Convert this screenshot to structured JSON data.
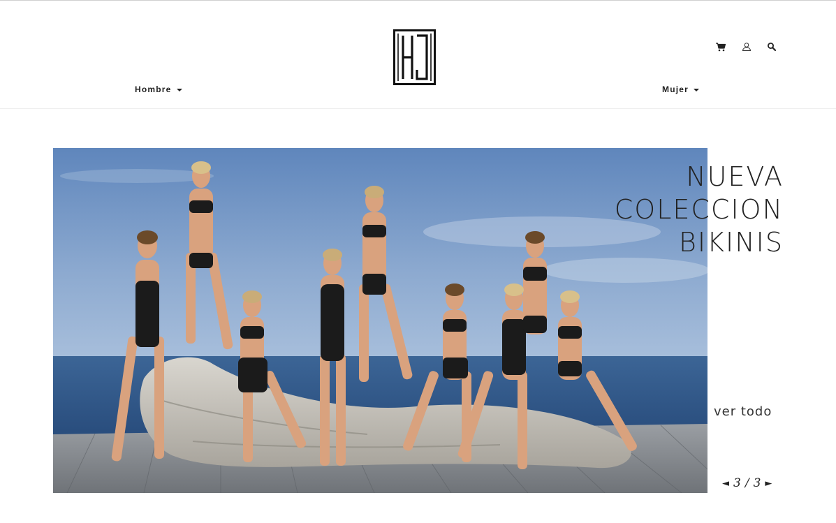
{
  "header": {
    "logo_text": "HJ",
    "nav": [
      {
        "label": "Hombre"
      },
      {
        "label": "Mujer"
      }
    ],
    "icons": [
      "cart-icon",
      "user-icon",
      "search-icon"
    ]
  },
  "hero": {
    "title_lines": [
      "NUEVA",
      "COLECCION",
      "BIKINIS"
    ],
    "cta_label": "ver todo",
    "pager": {
      "current": "3",
      "separator": "/",
      "total": "3",
      "prev_glyph": "◄",
      "next_glyph": "►"
    }
  },
  "colors": {
    "text": "#1a1a1a",
    "sky": "#6a8fc0",
    "sea": "#365d8f",
    "deck": "#8c8f94"
  }
}
